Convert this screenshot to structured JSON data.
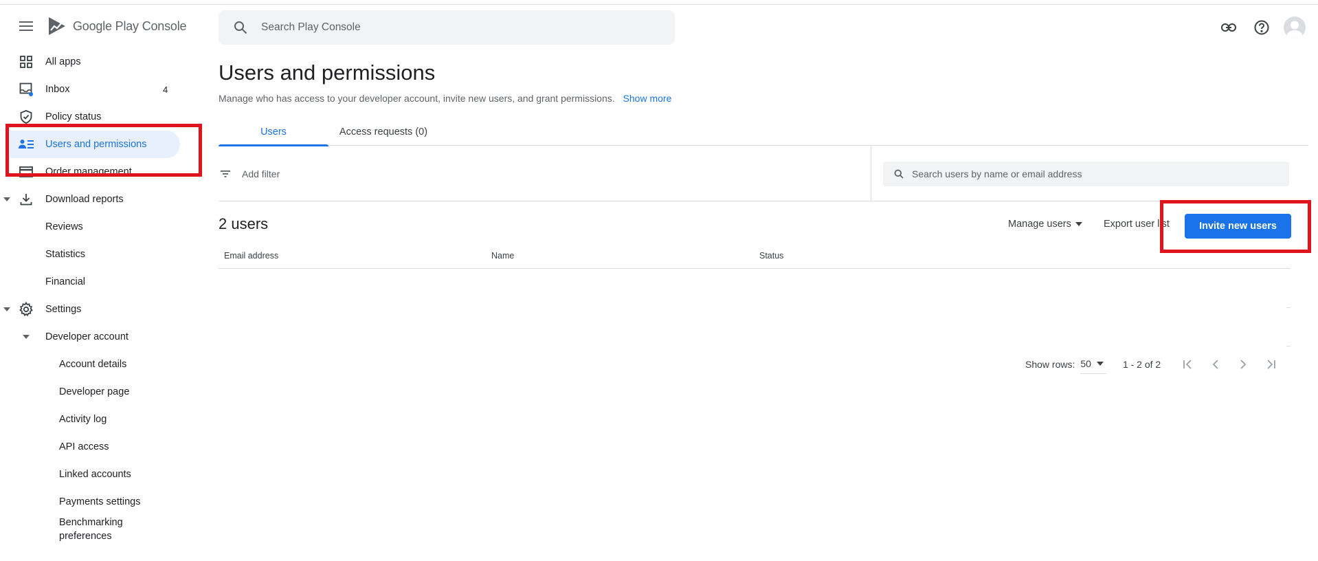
{
  "brand": {
    "google": "Google Play",
    "console": "Console"
  },
  "search": {
    "placeholder": "Search Play Console"
  },
  "sidebar": {
    "items": [
      {
        "label": "All apps",
        "icon": "grid-icon"
      },
      {
        "label": "Inbox",
        "icon": "inbox-icon",
        "badge": "4"
      },
      {
        "label": "Policy status",
        "icon": "shield-icon"
      },
      {
        "label": "Users and permissions",
        "icon": "people-list-icon"
      },
      {
        "label": "Order management",
        "icon": "card-icon"
      },
      {
        "label": "Download reports",
        "icon": "download-icon"
      },
      {
        "label": "Reviews"
      },
      {
        "label": "Statistics"
      },
      {
        "label": "Financial"
      },
      {
        "label": "Settings",
        "icon": "gear-icon"
      },
      {
        "label": "Developer account"
      },
      {
        "label": "Account details"
      },
      {
        "label": "Developer page"
      },
      {
        "label": "Activity log"
      },
      {
        "label": "API access"
      },
      {
        "label": "Linked accounts"
      },
      {
        "label": "Payments settings"
      },
      {
        "label": "Benchmarking"
      },
      {
        "label": "preferences"
      }
    ]
  },
  "page": {
    "title": "Users and permissions",
    "subtitle": "Manage who has access to your developer account, invite new users, and grant permissions.",
    "show_more": "Show more"
  },
  "tabs": [
    {
      "label": "Users"
    },
    {
      "label": "Access requests (0)"
    }
  ],
  "filter": {
    "label": "Add filter"
  },
  "user_search": {
    "placeholder": "Search users by name or email address"
  },
  "users_section": {
    "count": "2 users",
    "manage": "Manage users",
    "export": "Export user list",
    "invite": "Invite new users"
  },
  "table": {
    "columns": [
      "Email address",
      "Name",
      "Status"
    ]
  },
  "pager": {
    "rows_label": "Show rows:",
    "rows_value": "50",
    "range": "1 - 2 of 2"
  },
  "colors": {
    "accent": "#1a73e8",
    "highlight": "#e0141e",
    "active_bg": "#e8f0fe"
  }
}
